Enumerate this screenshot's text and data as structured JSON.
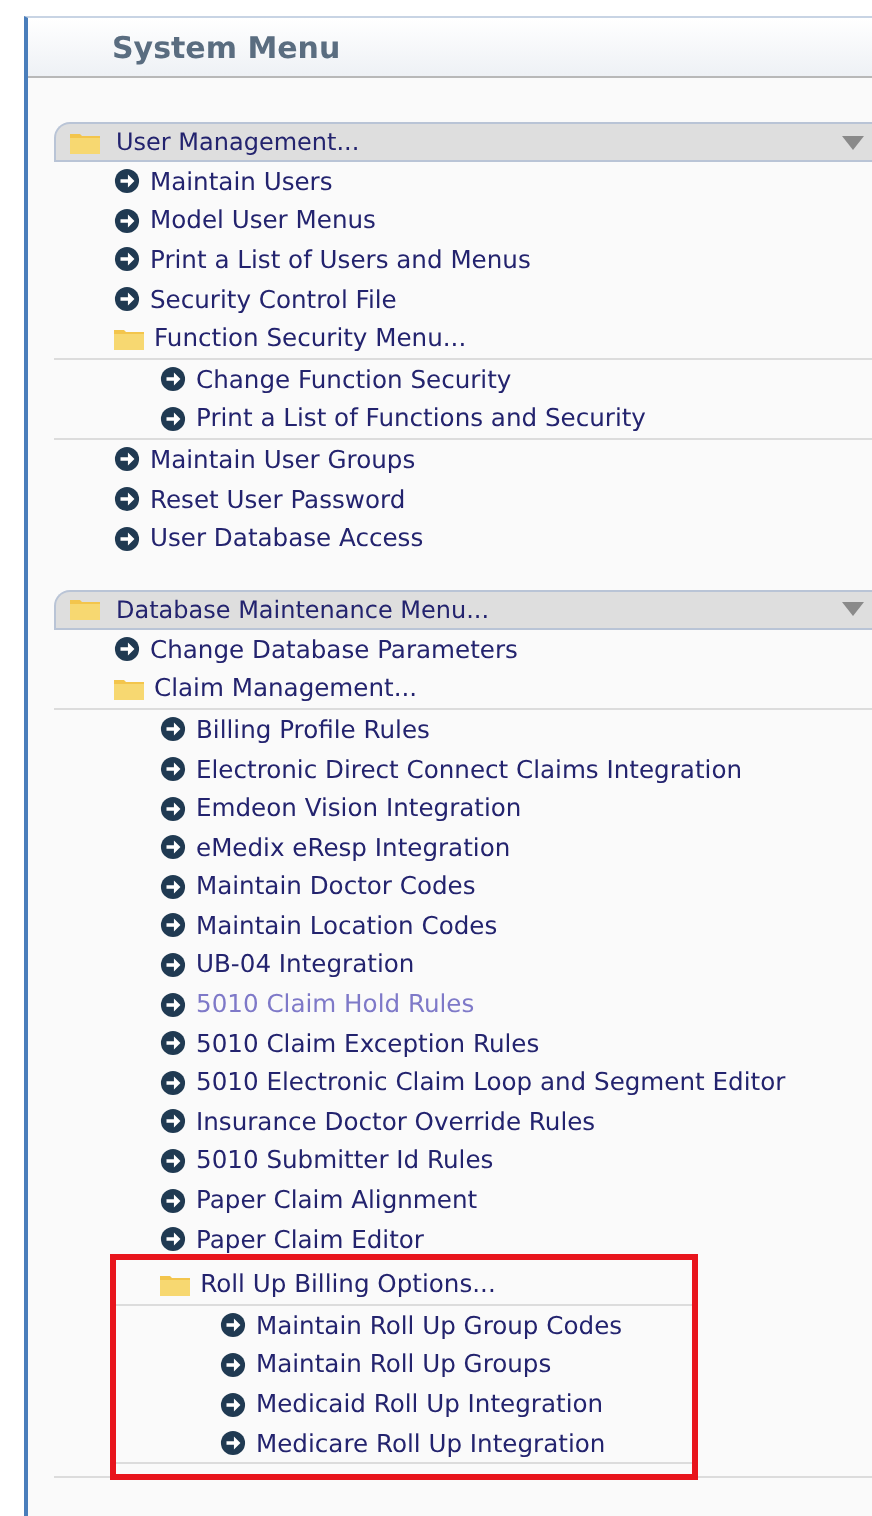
{
  "title": "System Menu",
  "sections": [
    {
      "label": "User Management...",
      "expanded": true,
      "items": [
        {
          "kind": "link",
          "label": "Maintain Users",
          "visited": false
        },
        {
          "kind": "link",
          "label": "Model User Menus",
          "visited": false
        },
        {
          "kind": "link",
          "label": "Print a List of Users and Menus",
          "visited": false
        },
        {
          "kind": "link",
          "label": "Security Control File",
          "visited": false
        },
        {
          "kind": "folder",
          "label": "Function Security Menu...",
          "highlighted": false,
          "children": [
            {
              "kind": "link",
              "label": "Change Function Security",
              "visited": false
            },
            {
              "kind": "link",
              "label": "Print a List of Functions and Security",
              "visited": false
            }
          ]
        },
        {
          "kind": "link",
          "label": "Maintain User Groups",
          "visited": false
        },
        {
          "kind": "link",
          "label": "Reset User Password",
          "visited": false
        },
        {
          "kind": "link",
          "label": "User Database Access",
          "visited": false
        }
      ]
    },
    {
      "label": "Database Maintenance Menu...",
      "expanded": true,
      "items": [
        {
          "kind": "link",
          "label": "Change Database Parameters",
          "visited": false
        },
        {
          "kind": "folder",
          "label": "Claim Management...",
          "highlighted": false,
          "children": [
            {
              "kind": "link",
              "label": "Billing Profile Rules",
              "visited": false
            },
            {
              "kind": "link",
              "label": "Electronic Direct Connect Claims Integration",
              "visited": false
            },
            {
              "kind": "link",
              "label": "Emdeon Vision Integration",
              "visited": false
            },
            {
              "kind": "link",
              "label": "eMedix eResp Integration",
              "visited": false
            },
            {
              "kind": "link",
              "label": "Maintain Doctor Codes",
              "visited": false
            },
            {
              "kind": "link",
              "label": "Maintain Location Codes",
              "visited": false
            },
            {
              "kind": "link",
              "label": "UB-04 Integration",
              "visited": false
            },
            {
              "kind": "link",
              "label": "5010 Claim Hold Rules",
              "visited": true
            },
            {
              "kind": "link",
              "label": "5010 Claim Exception Rules",
              "visited": false
            },
            {
              "kind": "link",
              "label": "5010 Electronic Claim Loop and Segment Editor",
              "visited": false
            },
            {
              "kind": "link",
              "label": "Insurance Doctor Override Rules",
              "visited": false
            },
            {
              "kind": "link",
              "label": "5010 Submitter Id Rules",
              "visited": false
            },
            {
              "kind": "link",
              "label": "Paper Claim Alignment",
              "visited": false
            },
            {
              "kind": "link",
              "label": "Paper Claim Editor",
              "visited": false
            },
            {
              "kind": "folder",
              "label": "Roll Up Billing Options...",
              "highlighted": true,
              "children": [
                {
                  "kind": "link",
                  "label": "Maintain Roll Up Group Codes",
                  "visited": false
                },
                {
                  "kind": "link",
                  "label": "Maintain Roll Up Groups",
                  "visited": false
                },
                {
                  "kind": "link",
                  "label": "Medicaid Roll Up Integration",
                  "visited": false
                },
                {
                  "kind": "link",
                  "label": "Medicare Roll Up Integration",
                  "visited": false
                }
              ]
            }
          ]
        }
      ]
    }
  ]
}
